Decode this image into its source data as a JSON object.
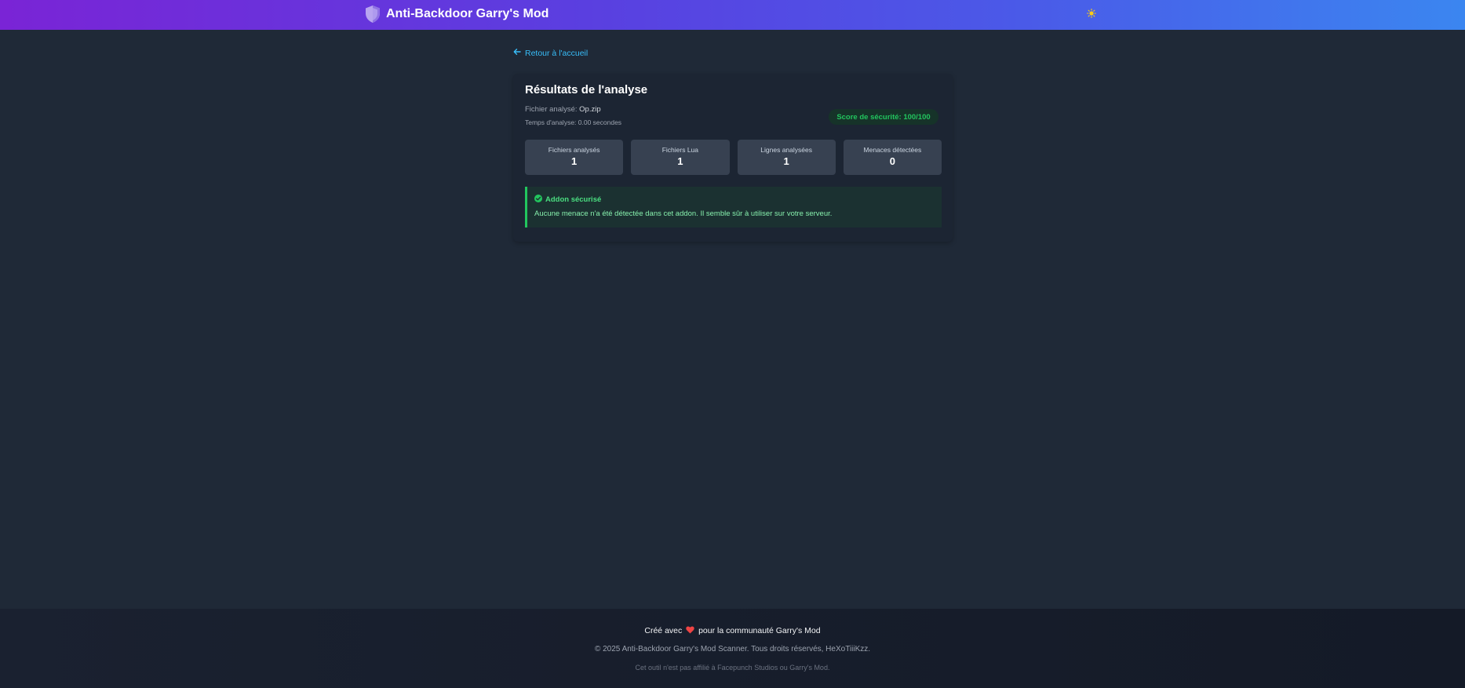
{
  "header": {
    "title": "Anti-Backdoor Garry's Mod",
    "logo_icon": "shield-icon",
    "theme_toggle_icon": "sun-icon",
    "gradient_start": "#7a24d6",
    "gradient_end": "#3b86f0"
  },
  "nav": {
    "back_label": "Retour à l'accueil",
    "back_icon": "arrow-left-icon"
  },
  "results": {
    "title": "Résultats de l'analyse",
    "file_label": "Fichier analysé:",
    "file_name": "Op.zip",
    "time_text": "Temps d'analyse: 0.00 secondes",
    "score_text": "Score de sécurité: 100/100",
    "stats": [
      {
        "label": "Fichiers analysés",
        "value": "1"
      },
      {
        "label": "Fichiers Lua",
        "value": "1"
      },
      {
        "label": "Lignes analysées",
        "value": "1"
      },
      {
        "label": "Menaces détectées",
        "value": "0"
      }
    ],
    "alert": {
      "icon": "check-circle-icon",
      "title": "Addon sécurisé",
      "text": "Aucune menace n'a été détectée dans cet addon. Il semble sûr à utiliser sur votre serveur.",
      "color": "#22c55e"
    }
  },
  "footer": {
    "made_prefix": "Créé avec",
    "made_suffix": "pour la communauté Garry's Mod",
    "heart_icon": "heart-icon",
    "copyright": "© 2025 Anti-Backdoor Garry's Mod Scanner. Tous droits réservés, HeXoTiiiKzz.",
    "disclaimer": "Cet outil n'est pas affilié à Facepunch Studios ou Garry's Mod."
  }
}
